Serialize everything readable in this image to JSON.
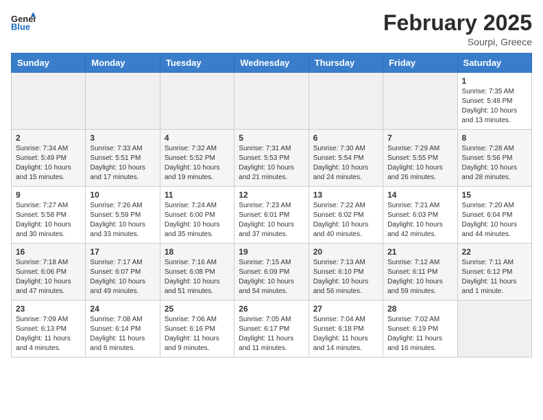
{
  "header": {
    "logo_text_general": "General",
    "logo_text_blue": "Blue",
    "month_title": "February 2025",
    "location": "Sourpi, Greece"
  },
  "days_of_week": [
    "Sunday",
    "Monday",
    "Tuesday",
    "Wednesday",
    "Thursday",
    "Friday",
    "Saturday"
  ],
  "weeks": [
    [
      {
        "day": "",
        "info": ""
      },
      {
        "day": "",
        "info": ""
      },
      {
        "day": "",
        "info": ""
      },
      {
        "day": "",
        "info": ""
      },
      {
        "day": "",
        "info": ""
      },
      {
        "day": "",
        "info": ""
      },
      {
        "day": "1",
        "info": "Sunrise: 7:35 AM\nSunset: 5:48 PM\nDaylight: 10 hours and 13 minutes."
      }
    ],
    [
      {
        "day": "2",
        "info": "Sunrise: 7:34 AM\nSunset: 5:49 PM\nDaylight: 10 hours and 15 minutes."
      },
      {
        "day": "3",
        "info": "Sunrise: 7:33 AM\nSunset: 5:51 PM\nDaylight: 10 hours and 17 minutes."
      },
      {
        "day": "4",
        "info": "Sunrise: 7:32 AM\nSunset: 5:52 PM\nDaylight: 10 hours and 19 minutes."
      },
      {
        "day": "5",
        "info": "Sunrise: 7:31 AM\nSunset: 5:53 PM\nDaylight: 10 hours and 21 minutes."
      },
      {
        "day": "6",
        "info": "Sunrise: 7:30 AM\nSunset: 5:54 PM\nDaylight: 10 hours and 24 minutes."
      },
      {
        "day": "7",
        "info": "Sunrise: 7:29 AM\nSunset: 5:55 PM\nDaylight: 10 hours and 26 minutes."
      },
      {
        "day": "8",
        "info": "Sunrise: 7:28 AM\nSunset: 5:56 PM\nDaylight: 10 hours and 28 minutes."
      }
    ],
    [
      {
        "day": "9",
        "info": "Sunrise: 7:27 AM\nSunset: 5:58 PM\nDaylight: 10 hours and 30 minutes."
      },
      {
        "day": "10",
        "info": "Sunrise: 7:26 AM\nSunset: 5:59 PM\nDaylight: 10 hours and 33 minutes."
      },
      {
        "day": "11",
        "info": "Sunrise: 7:24 AM\nSunset: 6:00 PM\nDaylight: 10 hours and 35 minutes."
      },
      {
        "day": "12",
        "info": "Sunrise: 7:23 AM\nSunset: 6:01 PM\nDaylight: 10 hours and 37 minutes."
      },
      {
        "day": "13",
        "info": "Sunrise: 7:22 AM\nSunset: 6:02 PM\nDaylight: 10 hours and 40 minutes."
      },
      {
        "day": "14",
        "info": "Sunrise: 7:21 AM\nSunset: 6:03 PM\nDaylight: 10 hours and 42 minutes."
      },
      {
        "day": "15",
        "info": "Sunrise: 7:20 AM\nSunset: 6:04 PM\nDaylight: 10 hours and 44 minutes."
      }
    ],
    [
      {
        "day": "16",
        "info": "Sunrise: 7:18 AM\nSunset: 6:06 PM\nDaylight: 10 hours and 47 minutes."
      },
      {
        "day": "17",
        "info": "Sunrise: 7:17 AM\nSunset: 6:07 PM\nDaylight: 10 hours and 49 minutes."
      },
      {
        "day": "18",
        "info": "Sunrise: 7:16 AM\nSunset: 6:08 PM\nDaylight: 10 hours and 51 minutes."
      },
      {
        "day": "19",
        "info": "Sunrise: 7:15 AM\nSunset: 6:09 PM\nDaylight: 10 hours and 54 minutes."
      },
      {
        "day": "20",
        "info": "Sunrise: 7:13 AM\nSunset: 6:10 PM\nDaylight: 10 hours and 56 minutes."
      },
      {
        "day": "21",
        "info": "Sunrise: 7:12 AM\nSunset: 6:11 PM\nDaylight: 10 hours and 59 minutes."
      },
      {
        "day": "22",
        "info": "Sunrise: 7:11 AM\nSunset: 6:12 PM\nDaylight: 11 hours and 1 minute."
      }
    ],
    [
      {
        "day": "23",
        "info": "Sunrise: 7:09 AM\nSunset: 6:13 PM\nDaylight: 11 hours and 4 minutes."
      },
      {
        "day": "24",
        "info": "Sunrise: 7:08 AM\nSunset: 6:14 PM\nDaylight: 11 hours and 6 minutes."
      },
      {
        "day": "25",
        "info": "Sunrise: 7:06 AM\nSunset: 6:16 PM\nDaylight: 11 hours and 9 minutes."
      },
      {
        "day": "26",
        "info": "Sunrise: 7:05 AM\nSunset: 6:17 PM\nDaylight: 11 hours and 11 minutes."
      },
      {
        "day": "27",
        "info": "Sunrise: 7:04 AM\nSunset: 6:18 PM\nDaylight: 11 hours and 14 minutes."
      },
      {
        "day": "28",
        "info": "Sunrise: 7:02 AM\nSunset: 6:19 PM\nDaylight: 11 hours and 16 minutes."
      },
      {
        "day": "",
        "info": ""
      }
    ]
  ]
}
